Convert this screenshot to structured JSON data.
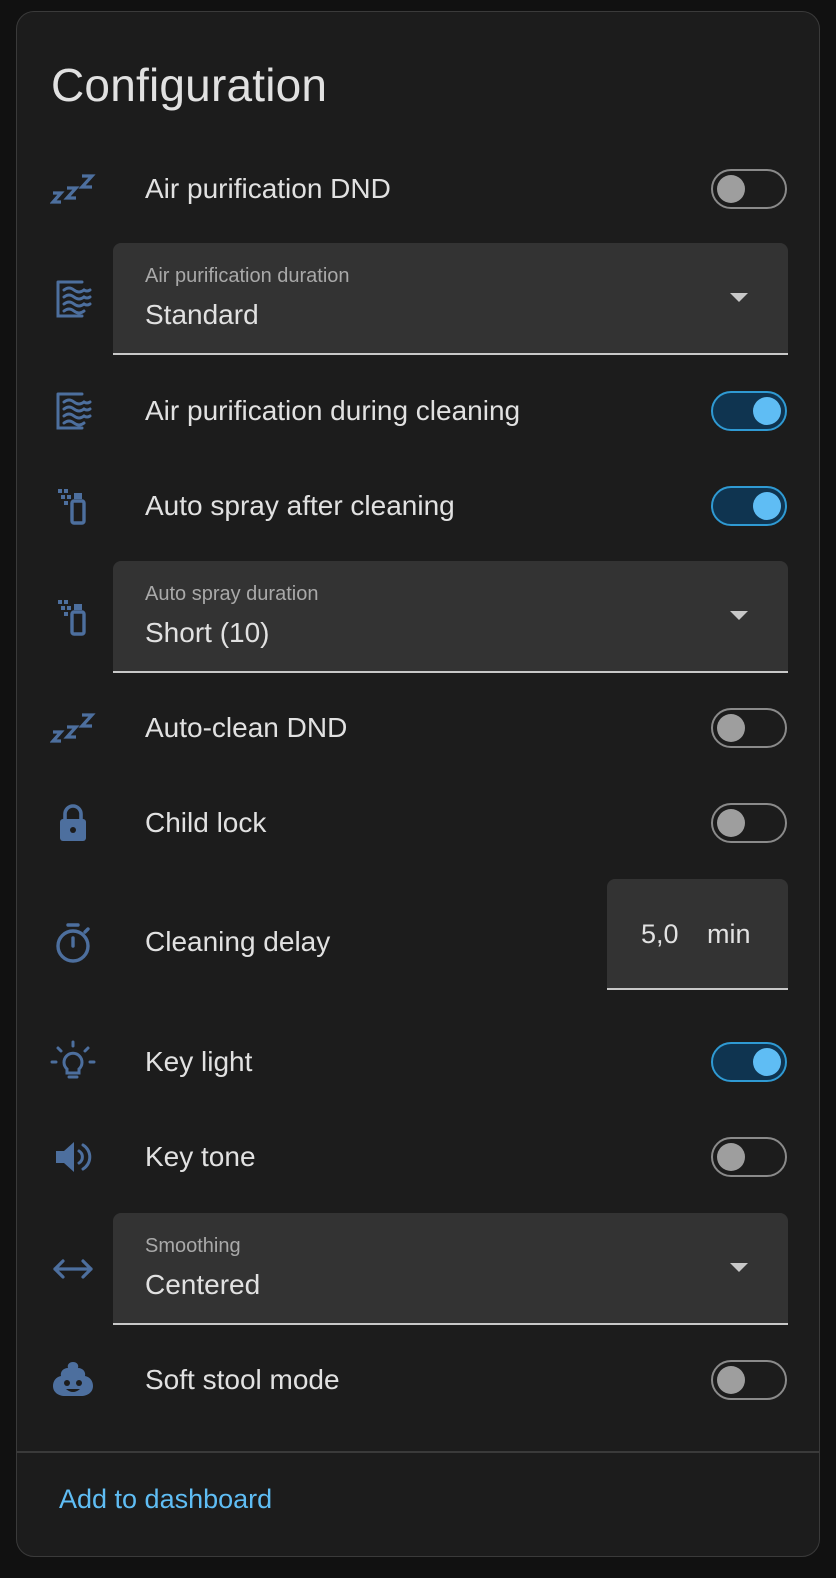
{
  "card": {
    "title": "Configuration",
    "footer_button": "Add to dashboard"
  },
  "colors": {
    "accent": "#5fbdf4",
    "icon": "#4d6f9e",
    "card_bg": "#1c1c1c",
    "field_bg": "#333333"
  },
  "rows": [
    {
      "type": "toggle",
      "icon": "sleep-icon",
      "label": "Air purification DND",
      "on": false
    },
    {
      "type": "select",
      "icon": "air-filter-icon",
      "label": "Air purification duration",
      "value": "Standard"
    },
    {
      "type": "toggle",
      "icon": "air-filter-icon",
      "label": "Air purification during cleaning",
      "on": true
    },
    {
      "type": "toggle",
      "icon": "spray-icon",
      "label": "Auto spray after cleaning",
      "on": true
    },
    {
      "type": "select",
      "icon": "spray-icon",
      "label": "Auto spray duration",
      "value": "Short (10)"
    },
    {
      "type": "toggle",
      "icon": "sleep-icon",
      "label": "Auto-clean DND",
      "on": false
    },
    {
      "type": "toggle",
      "icon": "lock-icon",
      "label": "Child lock",
      "on": false
    },
    {
      "type": "number",
      "icon": "timer-icon",
      "label": "Cleaning delay",
      "value": "5,0",
      "unit": "min"
    },
    {
      "type": "toggle",
      "icon": "lightbulb-icon",
      "label": "Key light",
      "on": true
    },
    {
      "type": "toggle",
      "icon": "volume-icon",
      "label": "Key tone",
      "on": false
    },
    {
      "type": "select",
      "icon": "arrow-left-right-icon",
      "label": "Smoothing",
      "value": "Centered"
    },
    {
      "type": "toggle",
      "icon": "emoticon-poop-icon",
      "label": "Soft stool mode",
      "on": false
    }
  ]
}
